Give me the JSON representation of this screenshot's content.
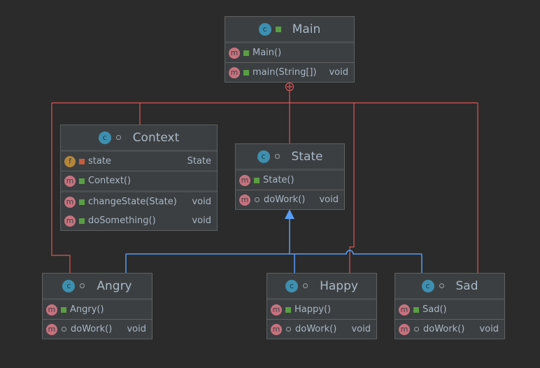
{
  "colors": {
    "background": "#2b2b2b",
    "inner_class_link": "#e05555",
    "generalization": "#589df6"
  },
  "classes": {
    "main": {
      "name": "Main",
      "icon": "class-runnable-icon",
      "visibility": "public",
      "members": [
        {
          "kind": "method",
          "visibility": "public",
          "name": "Main()",
          "type": ""
        },
        {
          "kind": "method",
          "visibility": "public",
          "name": "main(String[])",
          "type": "void"
        }
      ]
    },
    "context": {
      "name": "Context",
      "icon": "class-icon",
      "visibility": "package",
      "members": [
        {
          "kind": "field",
          "visibility": "private",
          "name": "state",
          "type": "State"
        },
        {
          "kind": "method",
          "visibility": "public",
          "name": "Context()",
          "type": ""
        },
        {
          "kind": "method",
          "visibility": "public",
          "name": "changeState(State)",
          "type": "void"
        },
        {
          "kind": "method",
          "visibility": "public",
          "name": "doSomething()",
          "type": "void"
        }
      ]
    },
    "state": {
      "name": "State",
      "icon": "abstract-class-icon",
      "visibility": "package",
      "members": [
        {
          "kind": "method",
          "visibility": "public",
          "name": "State()",
          "type": ""
        },
        {
          "kind": "method",
          "visibility": "package",
          "name": "doWork()",
          "type": "void"
        }
      ]
    },
    "angry": {
      "name": "Angry",
      "icon": "class-icon",
      "visibility": "package",
      "members": [
        {
          "kind": "method",
          "visibility": "public",
          "name": "Angry()",
          "type": ""
        },
        {
          "kind": "method",
          "visibility": "package",
          "name": "doWork()",
          "type": "void"
        }
      ]
    },
    "happy": {
      "name": "Happy",
      "icon": "class-icon",
      "visibility": "package",
      "members": [
        {
          "kind": "method",
          "visibility": "public",
          "name": "Happy()",
          "type": ""
        },
        {
          "kind": "method",
          "visibility": "package",
          "name": "doWork()",
          "type": "void"
        }
      ]
    },
    "sad": {
      "name": "Sad",
      "icon": "class-icon",
      "visibility": "package",
      "members": [
        {
          "kind": "method",
          "visibility": "public",
          "name": "Sad()",
          "type": ""
        },
        {
          "kind": "method",
          "visibility": "package",
          "name": "doWork()",
          "type": "void"
        }
      ]
    }
  }
}
